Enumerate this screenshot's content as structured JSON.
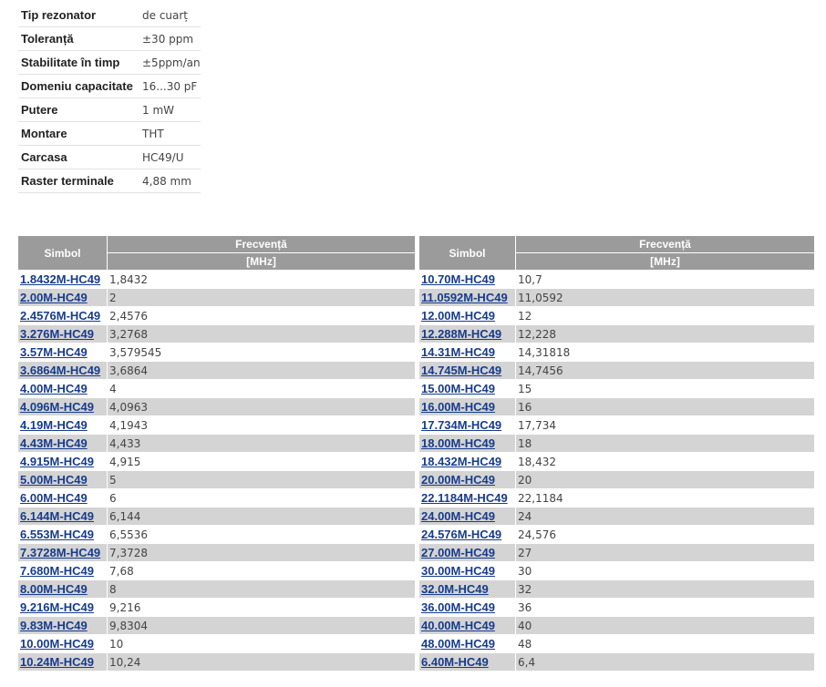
{
  "specs": [
    {
      "label": "Tip rezonator",
      "value": "de cuarț"
    },
    {
      "label": "Toleranță",
      "value": "±30 ppm"
    },
    {
      "label": "Stabilitate în timp",
      "value": "±5ppm/an"
    },
    {
      "label": "Domeniu capacitate",
      "value": "16...30 pF"
    },
    {
      "label": "Putere",
      "value": "1 mW"
    },
    {
      "label": "Montare",
      "value": "THT"
    },
    {
      "label": "Carcasa",
      "value": "HC49/U"
    },
    {
      "label": "Raster terminale",
      "value": "4,88 mm"
    }
  ],
  "table_headers": {
    "symbol": "Simbol",
    "frequency": "Frecvență",
    "frequency_unit": "[MHz]"
  },
  "left_rows": [
    {
      "symbol": "1.8432M-HC49",
      "freq": "1,8432"
    },
    {
      "symbol": "2.00M-HC49",
      "freq": "2"
    },
    {
      "symbol": "2.4576M-HC49",
      "freq": "2,4576"
    },
    {
      "symbol": "3.276M-HC49",
      "freq": "3,2768"
    },
    {
      "symbol": "3.57M-HC49",
      "freq": "3,579545"
    },
    {
      "symbol": "3.6864M-HC49",
      "freq": "3,6864"
    },
    {
      "symbol": "4.00M-HC49",
      "freq": "4"
    },
    {
      "symbol": "4.096M-HC49",
      "freq": "4,0963"
    },
    {
      "symbol": "4.19M-HC49",
      "freq": "4,1943"
    },
    {
      "symbol": "4.43M-HC49",
      "freq": "4,433"
    },
    {
      "symbol": "4.915M-HC49",
      "freq": "4,915"
    },
    {
      "symbol": "5.00M-HC49",
      "freq": "5"
    },
    {
      "symbol": "6.00M-HC49",
      "freq": "6"
    },
    {
      "symbol": "6.144M-HC49",
      "freq": "6,144"
    },
    {
      "symbol": "6.553M-HC49",
      "freq": "6,5536"
    },
    {
      "symbol": "7.3728M-HC49",
      "freq": "7,3728"
    },
    {
      "symbol": "7.680M-HC49",
      "freq": "7,68"
    },
    {
      "symbol": "8.00M-HC49",
      "freq": "8"
    },
    {
      "symbol": "9.216M-HC49",
      "freq": "9,216"
    },
    {
      "symbol": "9.83M-HC49",
      "freq": "9,8304"
    },
    {
      "symbol": "10.00M-HC49",
      "freq": "10"
    },
    {
      "symbol": "10.24M-HC49",
      "freq": "10,24"
    }
  ],
  "right_rows": [
    {
      "symbol": "10.70M-HC49",
      "freq": "10,7"
    },
    {
      "symbol": "11.0592M-HC49",
      "freq": "11,0592"
    },
    {
      "symbol": "12.00M-HC49",
      "freq": "12"
    },
    {
      "symbol": "12.288M-HC49",
      "freq": "12,228"
    },
    {
      "symbol": "14.31M-HC49",
      "freq": "14,31818"
    },
    {
      "symbol": "14.745M-HC49",
      "freq": "14,7456"
    },
    {
      "symbol": "15.00M-HC49",
      "freq": "15"
    },
    {
      "symbol": "16.00M-HC49",
      "freq": "16"
    },
    {
      "symbol": "17.734M-HC49",
      "freq": "17,734"
    },
    {
      "symbol": "18.00M-HC49",
      "freq": "18"
    },
    {
      "symbol": "18.432M-HC49",
      "freq": "18,432"
    },
    {
      "symbol": "20.00M-HC49",
      "freq": "20"
    },
    {
      "symbol": "22.1184M-HC49",
      "freq": "22,1184"
    },
    {
      "symbol": "24.00M-HC49",
      "freq": "24"
    },
    {
      "symbol": "24.576M-HC49",
      "freq": "24,576"
    },
    {
      "symbol": "27.00M-HC49",
      "freq": "27"
    },
    {
      "symbol": "30.00M-HC49",
      "freq": "30"
    },
    {
      "symbol": "32.0M-HC49",
      "freq": "32"
    },
    {
      "symbol": "36.00M-HC49",
      "freq": "36"
    },
    {
      "symbol": "40.00M-HC49",
      "freq": "40"
    },
    {
      "symbol": "48.00M-HC49",
      "freq": "48"
    },
    {
      "symbol": "6.40M-HC49",
      "freq": "6,4"
    }
  ]
}
